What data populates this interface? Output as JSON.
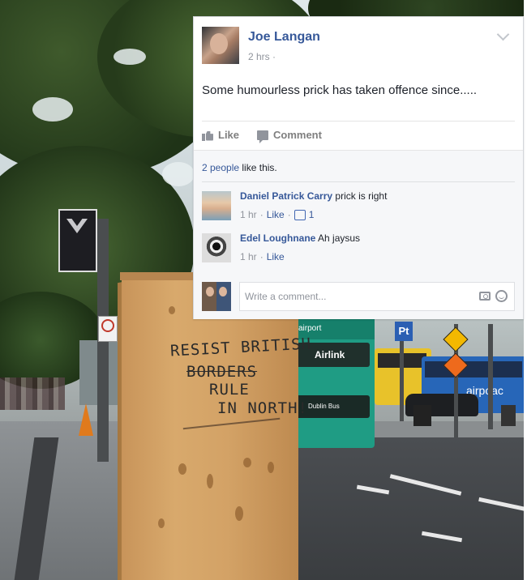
{
  "post": {
    "author": "Joe Langan",
    "timestamp": "2 hrs",
    "timestamp_suffix": "·",
    "text": "Some humourless prick has taken offence since.....",
    "actions": {
      "like": "Like",
      "comment": "Comment"
    },
    "likes_summary": {
      "count_link": "2 people",
      "suffix": "like this."
    },
    "comments": [
      {
        "author": "Daniel Patrick Carry",
        "text": "prick is right",
        "time": "1 hr",
        "separator": "·",
        "like_label": "Like",
        "like_count": "1"
      },
      {
        "author": "Edel Loughnane",
        "text": "Ah jaysus",
        "time": "1 hr",
        "separator": "·",
        "like_label": "Like"
      }
    ],
    "composer": {
      "placeholder": "Write a comment..."
    }
  },
  "photo": {
    "graffiti": [
      "RESIST BRITISH",
      "BORDERS",
      "RULE",
      "IN NORTH!"
    ],
    "bus_labels": {
      "route": "airport",
      "brand": "Airlink",
      "operator": "Dublin Bus",
      "side_ad": "airpoac"
    },
    "pt_sign": "Pt"
  }
}
